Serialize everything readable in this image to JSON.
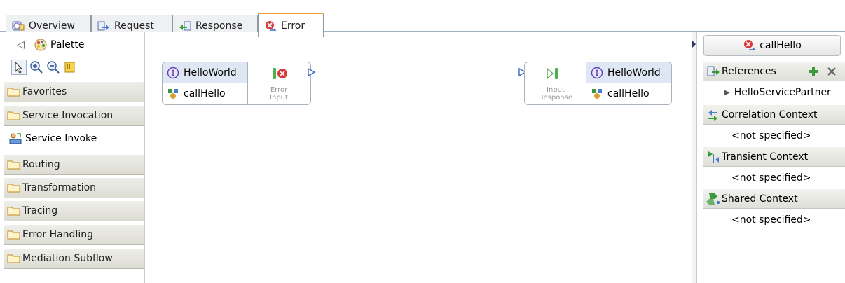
{
  "tabs": [
    {
      "label": "Overview",
      "icon": "overview-icon",
      "active": false
    },
    {
      "label": "Request",
      "icon": "request-icon",
      "active": false
    },
    {
      "label": "Response",
      "icon": "response-icon",
      "active": false
    },
    {
      "label": "Error",
      "icon": "error-icon",
      "active": true
    }
  ],
  "palette": {
    "title": "Palette",
    "tools": [
      "select-tool-icon",
      "zoom-in-icon",
      "zoom-out-icon",
      "note-icon"
    ],
    "drawers": {
      "favorites": "Favorites",
      "service_invocation": "Service Invocation",
      "routing": "Routing",
      "transformation": "Transformation",
      "tracing": "Tracing",
      "error_handling": "Error Handling",
      "mediation_subflow": "Mediation Subflow"
    },
    "entries": {
      "service_invoke": "Service Invoke"
    }
  },
  "canvas": {
    "left_node": {
      "interface": "HelloWorld",
      "operation": "callHello",
      "terminal": "Error Input"
    },
    "right_node": {
      "interface": "HelloWorld",
      "operation": "callHello",
      "terminal": "Input Response"
    }
  },
  "properties": {
    "operation": "callHello",
    "references": {
      "label": "References",
      "item": "HelloServicePartner"
    },
    "correlation": {
      "label": "Correlation Context",
      "value": "<not specified>"
    },
    "transient": {
      "label": "Transient Context",
      "value": "<not specified>"
    },
    "shared": {
      "label": "Shared Context",
      "value": "<not specified>"
    }
  },
  "colors": {
    "accent_tab": "#f0a030",
    "node_header": "#dfe7f5",
    "error_red": "#d83a3a",
    "add_green": "#3a9a3a"
  }
}
